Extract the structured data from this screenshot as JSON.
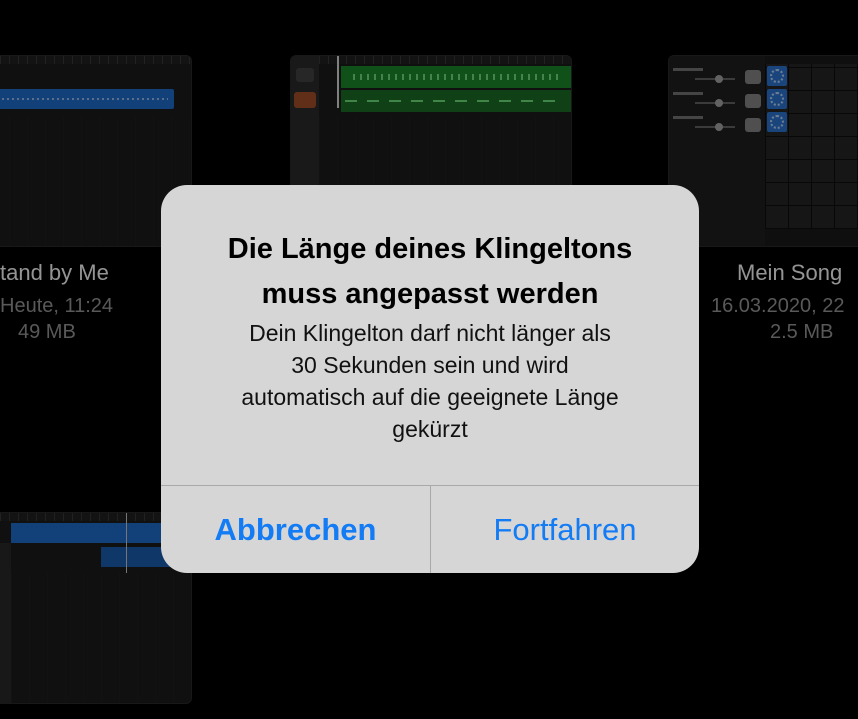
{
  "projects": [
    {
      "title": "tand by Me",
      "date": "Heute, 11:24",
      "size": "49 MB"
    },
    {
      "title": "Mein Song",
      "date": "16.03.2020, 22",
      "size": "2.5 MB"
    }
  ],
  "alert": {
    "title": "Die Länge deines Klingeltons\nmuss angepasst werden",
    "message": "Dein Klingelton darf nicht länger als\n30 Sekunden sein und wird\nautomatisch auf die geeignete Länge\ngekürzt",
    "cancel_label": "Abbrechen",
    "continue_label": "Fortfahren"
  },
  "colors": {
    "accent": "#137cf5",
    "alert_background": "#d6d6d6",
    "audio_region": "#1f6fd0",
    "midi_region": "#1d8a2b"
  }
}
